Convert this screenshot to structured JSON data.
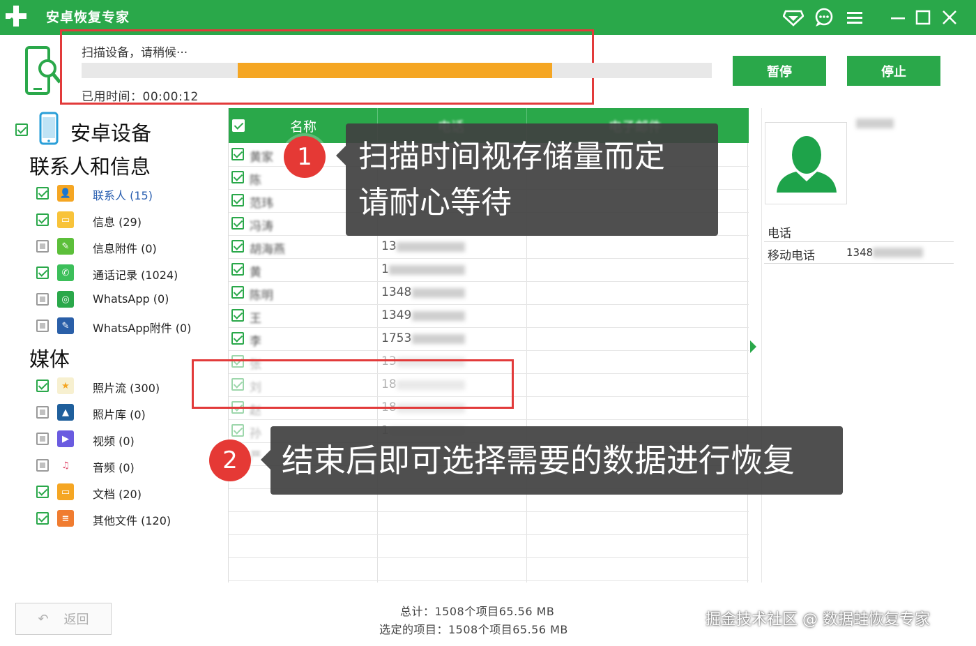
{
  "window": {
    "title": "安卓恢复专家",
    "accent": "#2aa84a"
  },
  "scan": {
    "status": "扫描设备，请稍候···",
    "progress": 0.74,
    "elapsed": "已用时间：00:00:12",
    "pause_label": "暂停",
    "stop_label": "停止"
  },
  "sidebar": {
    "device": "安卓设备",
    "section_contacts": "联系人和信息",
    "section_media": "媒体",
    "items": [
      {
        "label": "联系人 (15)",
        "icon": "contact-icon",
        "checked": true
      },
      {
        "label": "信息 (29)",
        "icon": "message-icon",
        "checked": true
      },
      {
        "label": "信息附件 (0)",
        "icon": "attachment-icon",
        "checked": false
      },
      {
        "label": "通话记录 (1024)",
        "icon": "phone-icon",
        "checked": true
      },
      {
        "label": "WhatsApp (0)",
        "icon": "whatsapp-icon",
        "checked": false
      },
      {
        "label": "WhatsApp附件 (0)",
        "icon": "whatsapp-attachment-icon",
        "checked": false
      },
      {
        "label": "照片流 (300)",
        "icon": "photo-stream-icon",
        "checked": true
      },
      {
        "label": "照片库 (0)",
        "icon": "photo-library-icon",
        "checked": false
      },
      {
        "label": "视频 (0)",
        "icon": "video-icon",
        "checked": false
      },
      {
        "label": "音频 (0)",
        "icon": "audio-icon",
        "checked": false
      },
      {
        "label": "文档 (20)",
        "icon": "document-icon",
        "checked": true
      },
      {
        "label": "其他文件 (120)",
        "icon": "other-files-icon",
        "checked": true
      }
    ]
  },
  "table": {
    "columns": [
      "名称",
      "电话",
      "电子邮件"
    ],
    "rows": [
      {
        "name": "黄家",
        "phone": ""
      },
      {
        "name": "陈",
        "phone": ""
      },
      {
        "name": "范玮",
        "phone": ""
      },
      {
        "name": "冯涛",
        "phone": ""
      },
      {
        "name": "胡海燕",
        "phone": "13"
      },
      {
        "name": "黄",
        "phone": "1"
      },
      {
        "name": "陈明",
        "phone": "1348"
      },
      {
        "name": "王",
        "phone": "1349"
      },
      {
        "name": "李",
        "phone": "1753"
      },
      {
        "name": "张",
        "phone": "13"
      },
      {
        "name": "刘",
        "phone": "18"
      },
      {
        "name": "赵",
        "phone": "18"
      },
      {
        "name": "孙",
        "phone": "1"
      },
      {
        "name": "严",
        "phone": ""
      }
    ]
  },
  "detail": {
    "name": "",
    "phone_heading": "电话",
    "mobile_label": "移动电话",
    "mobile_value": "1348"
  },
  "callouts": [
    {
      "number": "1",
      "text_line1": "扫描时间视存储量而定",
      "text_line2": "请耐心等待"
    },
    {
      "number": "2",
      "text_line1": "结束后即可选择需要的数据进行恢复"
    }
  ],
  "footer": {
    "back_label": "返回",
    "total": "总计：1508个项目65.56 MB",
    "selected": "选定的项目：1508个项目65.56 MB"
  },
  "watermark": "掘金技术社区 @ 数据蛙恢复专家"
}
